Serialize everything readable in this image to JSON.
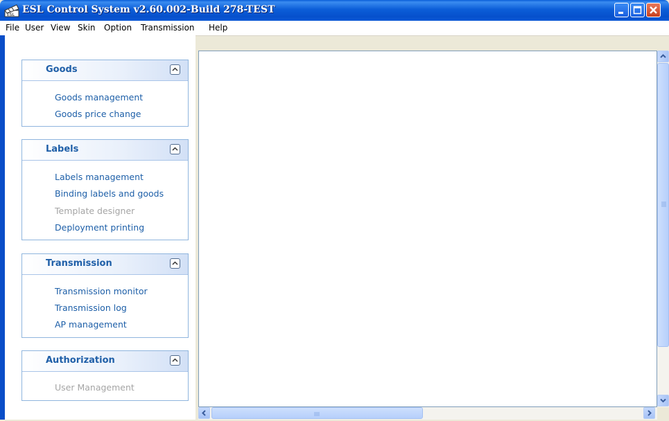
{
  "window": {
    "title": "ESL Control System v2.60.002-Build 278-TEST",
    "icon": "app-icon"
  },
  "menu": {
    "items": [
      "File",
      "User",
      "View",
      "Skin",
      "Option",
      "Transmission",
      "Help"
    ]
  },
  "sidebar": {
    "panels": [
      {
        "title": "Goods",
        "links": [
          {
            "label": "Goods management",
            "enabled": true
          },
          {
            "label": "Goods price change",
            "enabled": true
          }
        ]
      },
      {
        "title": "Labels",
        "links": [
          {
            "label": "Labels management",
            "enabled": true
          },
          {
            "label": "Binding labels and goods",
            "enabled": true
          },
          {
            "label": "Template designer",
            "enabled": false
          },
          {
            "label": "Deployment printing",
            "enabled": true
          }
        ]
      },
      {
        "title": "Transmission",
        "links": [
          {
            "label": "Transmission monitor",
            "enabled": true
          },
          {
            "label": "Transmission log",
            "enabled": true
          },
          {
            "label": "AP management",
            "enabled": true
          }
        ]
      },
      {
        "title": "Authorization",
        "links": [
          {
            "label": "User Management",
            "enabled": false
          }
        ]
      }
    ]
  },
  "colors": {
    "titlebar": "#0a5fd8",
    "link": "#1d5fa8",
    "link_disabled": "#a5a5a5",
    "panel_title": "#1f5fa8",
    "close_button": "#c8401e"
  }
}
